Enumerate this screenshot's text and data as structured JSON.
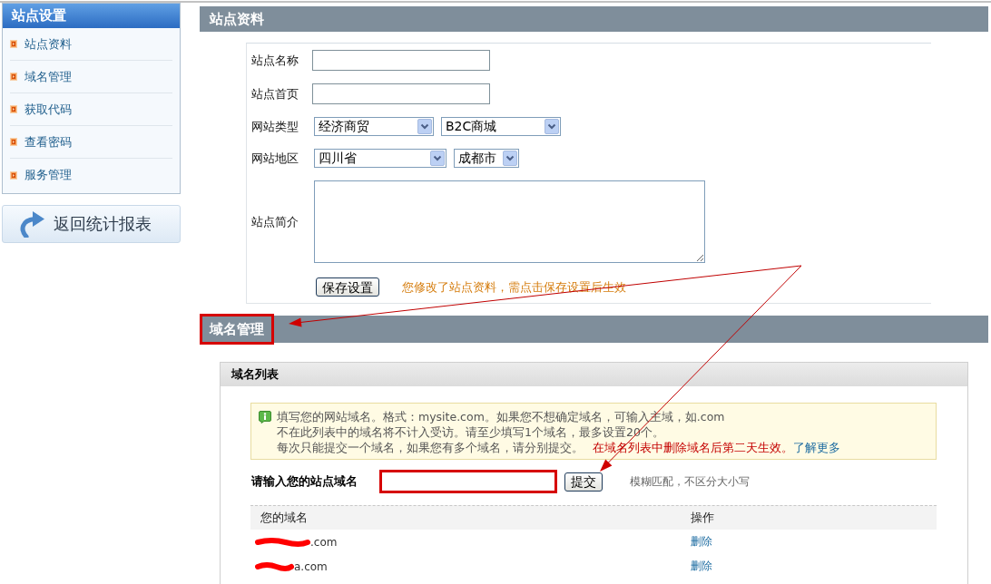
{
  "sidebar": {
    "title": "站点设置",
    "items": [
      "站点资料",
      "域名管理",
      "获取代码",
      "查看密码",
      "服务管理"
    ],
    "back_button": "返回统计报表"
  },
  "site_info": {
    "title": "站点资料",
    "fields": [
      {
        "kind": "text",
        "label": "站点名称"
      },
      {
        "kind": "text",
        "label": "站点首页"
      },
      {
        "kind": "select",
        "label": "网站类型",
        "selects": [
          {
            "value": "经济商贸"
          },
          {
            "value": "B2C商城"
          }
        ]
      },
      {
        "kind": "select",
        "label": "网站地区",
        "selects": [
          {
            "value": "四川省"
          },
          {
            "value": "成都市"
          }
        ]
      },
      {
        "kind": "textarea",
        "label": "站点简介"
      }
    ],
    "save_button": "保存设置",
    "notice": "您修改了站点资料，需点击保存设置后生效"
  },
  "domain_management": {
    "title": "域名管理",
    "highlighted": true,
    "panel": {
      "title": "域名列表",
      "notice": {
        "lines": [
          "填写您的网站域名。格式：mysite.com。如果您不想确定域名，可输入主域，如.com",
          "不在此列表中的域名将不计入受访。请至少填写1个域名，最多设置20个。",
          "每次只能提交一个域名，如果您有多个域名，请分别提交。"
        ],
        "warning": "在域名列表中删除域名后第二天生效。",
        "link": "了解更多"
      },
      "input": {
        "label": "请输入您的站点域名",
        "highlighted": true
      },
      "submit_button": "提交",
      "hint": "模糊匹配，不区分大小写",
      "table": {
        "columns": [
          "您的域名",
          "操作"
        ],
        "rows": [
          {
            "domain": ".com",
            "redacted": true,
            "action": "删除"
          },
          {
            "domain": "a.com",
            "redacted": true,
            "action": "删除"
          }
        ]
      }
    }
  }
}
